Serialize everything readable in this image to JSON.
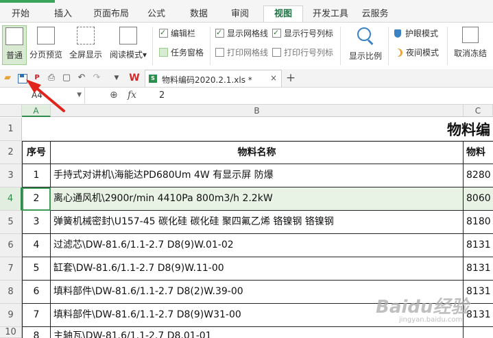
{
  "ribbon_tabs": [
    "开始",
    "插入",
    "页面布局",
    "公式",
    "数据",
    "审阅",
    "视图",
    "开发工具",
    "云服务"
  ],
  "active_tab": "视图",
  "view_ribbon": {
    "normal": "普通",
    "page_break_preview": "分页预览",
    "full_screen": "全屏显示",
    "reading_mode": "阅读模式",
    "reading_mode_dropdown": "▾",
    "edit_bar": "编辑栏",
    "task_pane": "任务窗格",
    "show_gridlines": "显示网格线",
    "print_gridlines": "打印网格线",
    "show_row_col_headers": "显示行号列标",
    "print_row_col_headers": "打印行号列标",
    "zoom": "显示比例",
    "eye_protection": "护眼模式",
    "night_mode": "夜间模式",
    "unfreeze": "取消冻结"
  },
  "checkbox_states": {
    "edit_bar": true,
    "task_pane": false,
    "show_gridlines": true,
    "print_gridlines": false,
    "show_row_col_headers": true,
    "print_row_col_headers": false
  },
  "document_tab": {
    "filename": "物料编码2020.2.1.xls *",
    "close": "×",
    "add": "+"
  },
  "formula_bar": {
    "cell_ref": "A4",
    "fx": "fx",
    "value": "2"
  },
  "columns": [
    "A",
    "B",
    "C"
  ],
  "row_numbers": [
    "1",
    "2",
    "3",
    "4",
    "5",
    "6",
    "7",
    "8",
    "9",
    "10"
  ],
  "sheet": {
    "title": "物料编",
    "headers": {
      "seq": "序号",
      "name": "物料名称",
      "code": "物料"
    },
    "rows": [
      {
        "seq": "1",
        "name": "手持式对讲机\\海能达PD680Um 4W 有显示屏 防爆",
        "code": "8280"
      },
      {
        "seq": "2",
        "name": "离心通风机\\2900r/min 4410Pa 800m3/h 2.2kW",
        "code": "8060"
      },
      {
        "seq": "3",
        "name": "弹簧机械密封\\U157-45 碳化硅 碳化硅 聚四氟乙烯 铬镍钢 铬镍钢",
        "code": "8180"
      },
      {
        "seq": "4",
        "name": "过滤芯\\DW-81.6/1.1-2.7 D8(9)W.01-02",
        "code": "8131"
      },
      {
        "seq": "5",
        "name": "缸套\\DW-81.6/1.1-2.7 D8(9)W.11-00",
        "code": "8131"
      },
      {
        "seq": "6",
        "name": "填料部件\\DW-81.6/1.1-2.7 D8(2)W.39-00",
        "code": "8131"
      },
      {
        "seq": "7",
        "name": "填料部件\\DW-81.6/1.1-2.7 D8(9)W31-00",
        "code": "8131"
      },
      {
        "seq": "8",
        "name": "主轴瓦\\DW-81.6/1.1-2.7 D8.01-01",
        "code": ""
      }
    ]
  },
  "selected_row": "4",
  "selected_column": "A",
  "watermark": {
    "brand": "Baidu经验",
    "url": "jingyan.baidu.com"
  },
  "colors": {
    "accent": "#217346",
    "selection": "#3b9a55",
    "arrow": "#e0241b"
  }
}
